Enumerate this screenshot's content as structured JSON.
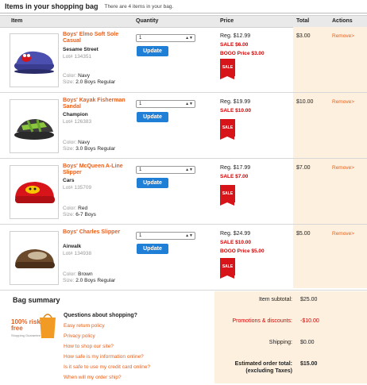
{
  "header": {
    "title": "Items in your shopping bag",
    "count_text": "There are 4 items in your bag."
  },
  "columns": {
    "item": "Item",
    "quantity": "Quantity",
    "price": "Price",
    "total": "Total",
    "actions": "Actions"
  },
  "items": [
    {
      "name": "Boys' Elmo Soft Sole Casual",
      "brand": "Sesame Street",
      "lot": "Lot# 134351",
      "color_label": "Color:",
      "color": "Navy",
      "size_label": "Size:",
      "size": "2.0 Boys Regular",
      "qty": "1",
      "update": "Update",
      "reg": "Reg. $12.99",
      "sale": "SALE $6.00",
      "bogo": "BOGO Price $3.00",
      "tag": "SALE",
      "total": "$3.00",
      "remove": "Remove>"
    },
    {
      "name": "Boys' Kayak Fisherman Sandal",
      "brand": "Champion",
      "lot": "Lot# 126383",
      "color_label": "Color:",
      "color": "Navy",
      "size_label": "Size:",
      "size": "3.0 Boys Regular",
      "qty": "1",
      "update": "Update",
      "reg": "Reg. $19.99",
      "sale": "SALE $10.00",
      "bogo": "",
      "tag": "SALE",
      "total": "$10.00",
      "remove": "Remove>"
    },
    {
      "name": "Boys' McQueen A-Line Slipper",
      "brand": "Cars",
      "lot": "Lot# 135709",
      "color_label": "Color:",
      "color": "Red",
      "size_label": "Size:",
      "size": "6-7 Boys",
      "qty": "1",
      "update": "Update",
      "reg": "Reg. $17.99",
      "sale": "SALE $7.00",
      "bogo": "",
      "tag": "SALE",
      "total": "$7.00",
      "remove": "Remove>"
    },
    {
      "name": "Boys' Charles Slipper",
      "brand": "Airwalk",
      "lot": "Lot# 134938",
      "color_label": "Color:",
      "color": "Brown",
      "size_label": "Size:",
      "size": "2.0 Boys Regular",
      "qty": "1",
      "update": "Update",
      "reg": "Reg. $24.99",
      "sale": "SALE $10.00",
      "bogo": "BOGO Price $5.00",
      "tag": "SALE",
      "total": "$5.00",
      "remove": "Remove>"
    }
  ],
  "summary": {
    "title": "Bag summary",
    "logo_text": "100% risk free",
    "logo_sub": "Shopping Guarantee",
    "questions_title": "Questions about shopping?",
    "links": [
      "Easy return policy",
      "Privacy policy",
      "How to shop our site?",
      "How safe is my information online?",
      "Is it safe to use my credit card online?",
      "When will my order ship?"
    ],
    "subtotal_label": "Item subtotal:",
    "subtotal": "$25.00",
    "promo_label": "Promotions & discounts:",
    "promo": "-$10.00",
    "shipping_label": "Shipping:",
    "shipping": "$0.00",
    "order_total_label": "Estimated order total:",
    "order_total_sub": "(excluding Taxes)",
    "order_total": "$15.00"
  },
  "colors": {
    "accent": "#e8601c",
    "sale_red": "#d40000",
    "button_blue": "#1f7fd6",
    "panel_peach": "#fdf0de"
  }
}
